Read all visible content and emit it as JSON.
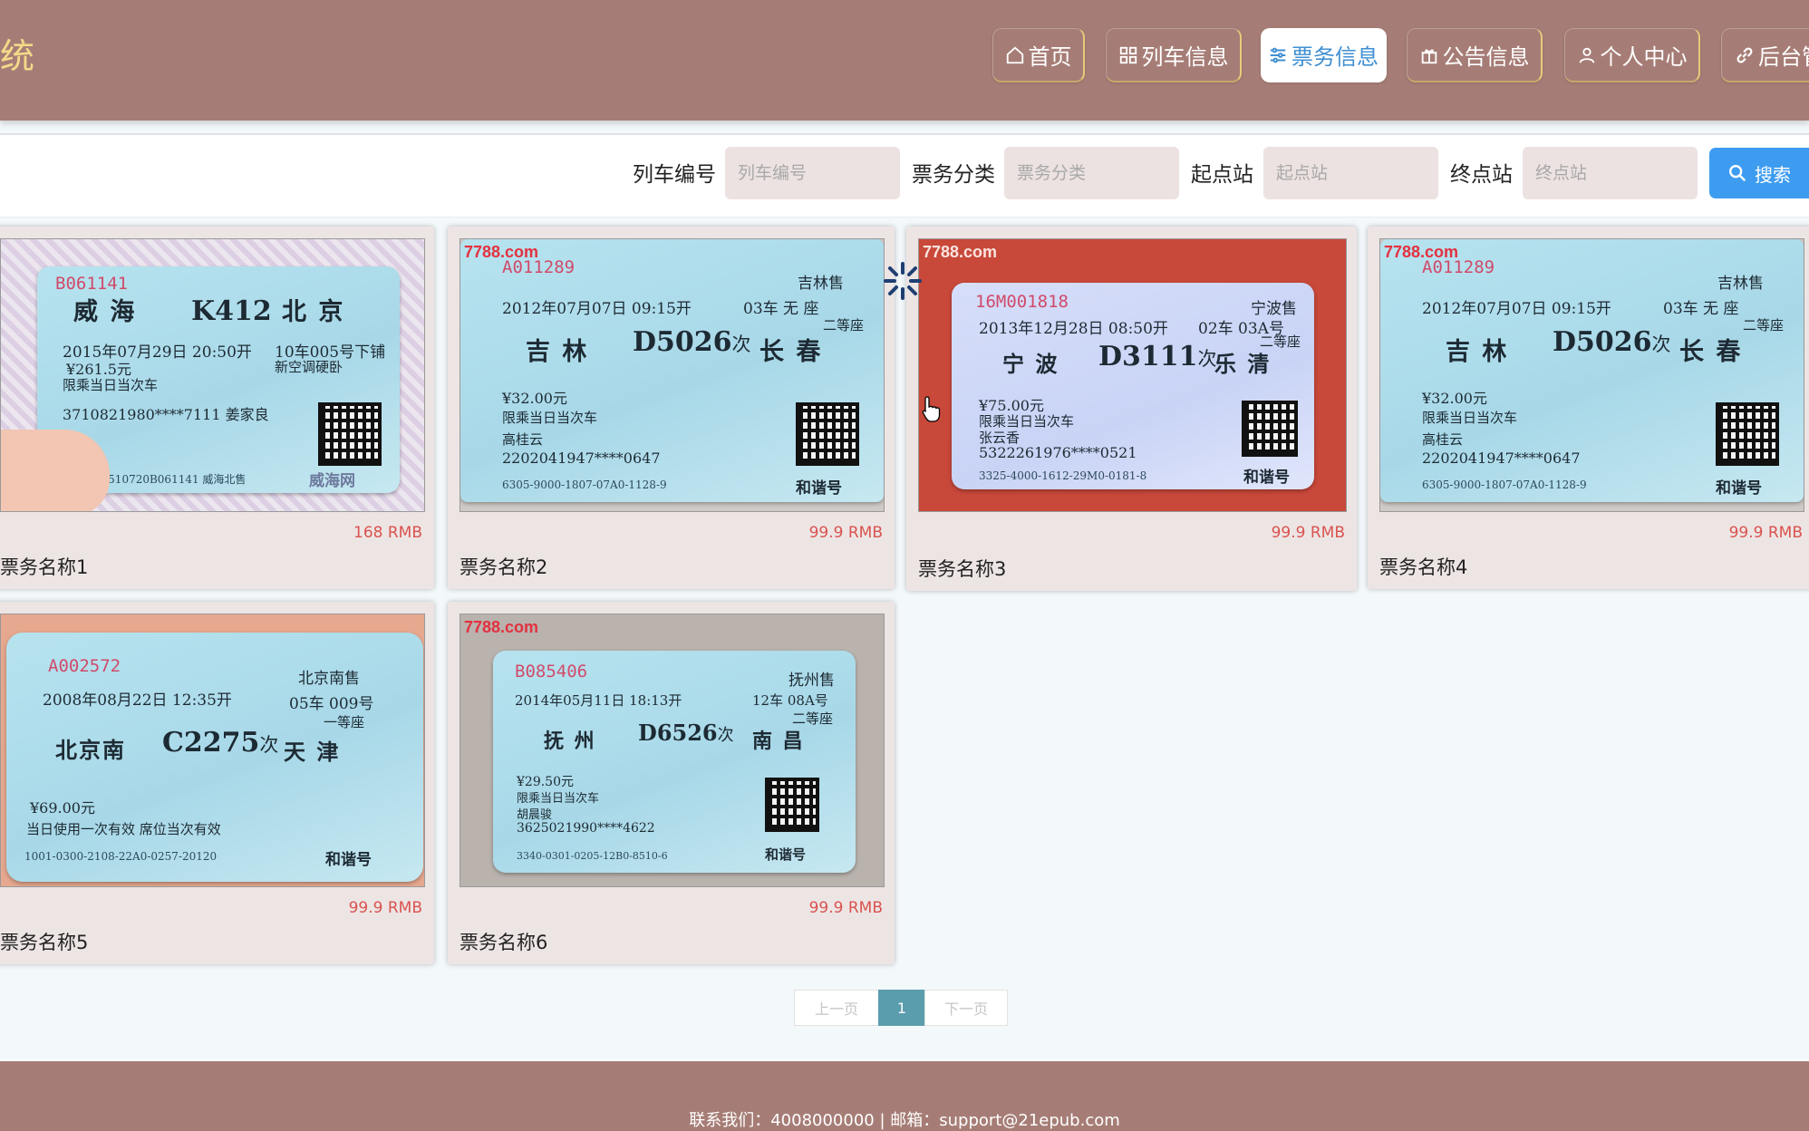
{
  "header": {
    "title": "统",
    "nav": [
      {
        "label": "首页",
        "icon": "home-icon"
      },
      {
        "label": "列车信息",
        "icon": "grid-icon"
      },
      {
        "label": "票务信息",
        "icon": "sliders-icon",
        "active": true
      },
      {
        "label": "公告信息",
        "icon": "gift-icon"
      },
      {
        "label": "个人中心",
        "icon": "user-icon"
      },
      {
        "label": "后台管",
        "icon": "link-icon"
      }
    ]
  },
  "search": {
    "fields": [
      {
        "label": "列车编号",
        "placeholder": "列车编号",
        "value": ""
      },
      {
        "label": "票务分类",
        "placeholder": "票务分类",
        "value": ""
      },
      {
        "label": "起点站",
        "placeholder": "起点站",
        "value": ""
      },
      {
        "label": "终点站",
        "placeholder": "终点站",
        "value": ""
      }
    ],
    "button_label": "搜索"
  },
  "cards": [
    {
      "name": "票务名称1",
      "price": "168 RMB",
      "ticket": {
        "serial": "B061141",
        "seller": "",
        "date": "2015年07月29日 20:50开",
        "from": "威 海",
        "to": "北 京",
        "train": "K412",
        "train_suffix": "",
        "car": "10车005号下铺",
        "seat": "新空调硬卧",
        "price": "¥261.5元",
        "note": "限乘当日当次车",
        "passenger": "",
        "id": "3710821980****7111 姜家良",
        "code": "71300510720B061141  威海北售",
        "brand": "",
        "watermark": "威海网"
      }
    },
    {
      "name": "票务名称2",
      "price": "99.9 RMB",
      "ticket": {
        "serial": "A011289",
        "seller": "吉林售",
        "date": "2012年07月07日 09:15开",
        "from": "吉 林",
        "to": "长 春",
        "train": "D5026",
        "train_suffix": "次",
        "car": "03车 无 座",
        "seat": "二等座",
        "price": "¥32.00元",
        "note": "限乘当日当次车",
        "passenger": "高桂云",
        "id": "2202041947****0647",
        "code": "6305-9000-1807-07A0-1128-9",
        "brand": "和谐号",
        "watermark": "7788.com"
      }
    },
    {
      "name": "票务名称3",
      "price": "99.9 RMB",
      "ticket": {
        "serial": "16M001818",
        "seller": "宁波售",
        "date": "2013年12月28日 08:50开",
        "from": "宁 波",
        "to": "乐 清",
        "train": "D3111",
        "train_suffix": "次",
        "car": "02车 03A号",
        "seat": "二等座",
        "price": "¥75.00元",
        "note": "限乘当日当次车",
        "passenger": "张云香",
        "id": "5322261976****0521",
        "code": "3325-4000-1612-29M0-0181-8",
        "brand": "和谐号",
        "watermark": "7788.com"
      }
    },
    {
      "name": "票务名称4",
      "price": "99.9 RMB",
      "ticket": {
        "serial": "A011289",
        "seller": "吉林售",
        "date": "2012年07月07日 09:15开",
        "from": "吉 林",
        "to": "长 春",
        "train": "D5026",
        "train_suffix": "次",
        "car": "03车 无 座",
        "seat": "二等座",
        "price": "¥32.00元",
        "note": "限乘当日当次车",
        "passenger": "高桂云",
        "id": "2202041947****0647",
        "code": "6305-9000-1807-07A0-1128-9",
        "brand": "和谐号",
        "watermark": "7788.com"
      }
    },
    {
      "name": "票务名称5",
      "price": "99.9 RMB",
      "ticket": {
        "serial": "A002572",
        "seller": "北京南售",
        "date": "2008年08月22日 12:35开",
        "from": "北京南",
        "to": "天 津",
        "train": "C2275",
        "train_suffix": "次",
        "car": "05车 009号",
        "seat": "一等座",
        "price": "¥69.00元",
        "note": "当日使用一次有效 席位当次有效",
        "passenger": "",
        "id": "",
        "code": "1001-0300-2108-22A0-0257-20120",
        "brand": "和谐号",
        "watermark": ""
      }
    },
    {
      "name": "票务名称6",
      "price": "99.9 RMB",
      "ticket": {
        "serial": "B085406",
        "seller": "抚州售",
        "date": "2014年05月11日 18:13开",
        "from": "抚 州",
        "to": "南 昌",
        "train": "D6526",
        "train_suffix": "次",
        "car": "12车 08A号",
        "seat": "二等座",
        "price": "¥29.50元",
        "note": "限乘当日当次车",
        "passenger": "胡晨骏",
        "id": "3625021990****4622",
        "code": "3340-0301-0205-12B0-8510-6",
        "brand": "和谐号",
        "watermark": "7788.com"
      }
    }
  ],
  "pagination": {
    "prev": "上一页",
    "current": "1",
    "next": "下一页"
  },
  "footer": {
    "contact_label": "联系我们：",
    "phone": "4008000000",
    "separator": " | ",
    "email_label": "邮箱：",
    "email": "support@21epub.com"
  },
  "colors": {
    "header_bg": "#a67d76",
    "active_tab_text": "#3f8fd2",
    "search_button": "#3d9cf0",
    "price": "#d9534f",
    "pager_active": "#5a9dad"
  }
}
